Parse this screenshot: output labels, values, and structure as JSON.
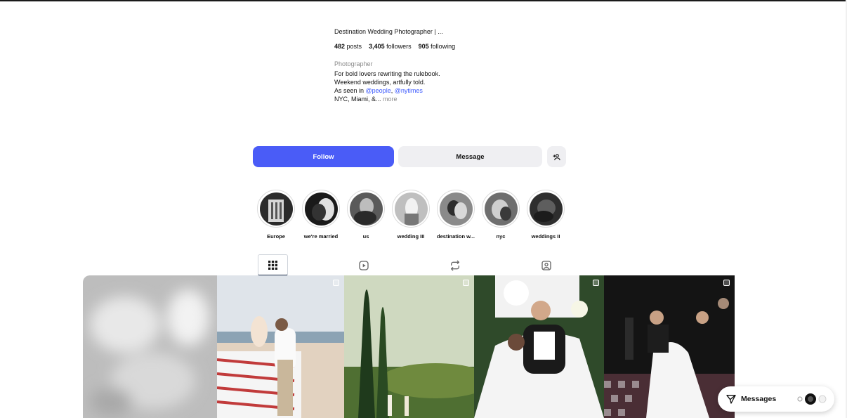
{
  "profile": {
    "bio_name": "Destination Wedding Photographer | ...",
    "stats": {
      "posts_count": "482",
      "posts_label": "posts",
      "followers_count": "3,405",
      "followers_label": "followers",
      "following_count": "905",
      "following_label": "following"
    },
    "category": "Photographer",
    "bio_line1": "For bold lovers rewriting the rulebook.",
    "bio_line2": "Weekend weddings, artfully told.",
    "bio_line3_prefix": "As seen in ",
    "mention1": "@people",
    "mention_separator": ", ",
    "mention2": "@nytimes",
    "bio_line4": "NYC, Miami, &...",
    "more_label": "more"
  },
  "actions": {
    "follow_label": "Follow",
    "message_label": "Message",
    "add_person_icon": "add-person-icon"
  },
  "highlights": [
    {
      "label": "Europe"
    },
    {
      "label": "we're married"
    },
    {
      "label": "us"
    },
    {
      "label": "wedding III"
    },
    {
      "label": "destination w..."
    },
    {
      "label": "nyc"
    },
    {
      "label": "weddings II"
    }
  ],
  "tabs": [
    {
      "icon": "grid-icon",
      "active": true
    },
    {
      "icon": "reels-icon",
      "active": false
    },
    {
      "icon": "reposts-icon",
      "active": false
    },
    {
      "icon": "tagged-icon",
      "active": false
    }
  ],
  "messages": {
    "label": "Messages",
    "icon": "send-icon"
  },
  "colors": {
    "follow_button": "#4a5cf7",
    "secondary_button": "#efeff2",
    "mention": "#3d5afe"
  }
}
